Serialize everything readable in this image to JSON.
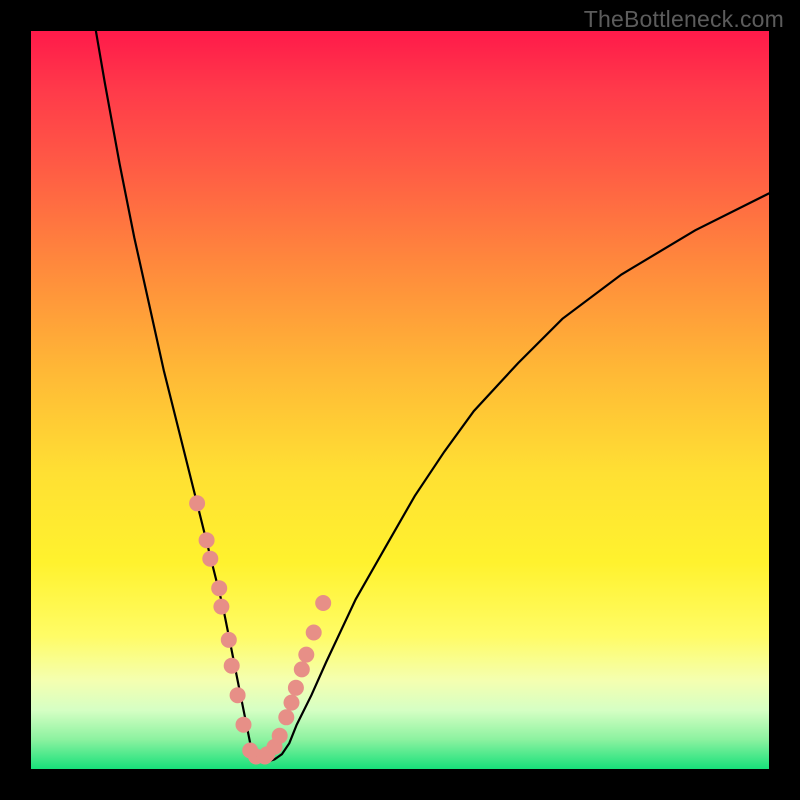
{
  "watermark": "TheBottleneck.com",
  "chart_data": {
    "type": "line",
    "title": "",
    "xlabel": "",
    "ylabel": "",
    "xlim": [
      0,
      100
    ],
    "ylim": [
      0,
      100
    ],
    "grid": false,
    "notes": "No axis ticks or numeric labels are visible; values are normalized 0–100 to the plot area. Colored background is a smooth gradient from red (top) through orange/yellow to green (bottom). A black V-shaped curve descends steeply on the left, touches the bottom near x≈30, and rises more gradually toward the right edge. Salmon dot markers cluster on both flanks of the valley.",
    "series": [
      {
        "name": "curve",
        "color": "#000000",
        "x": [
          8.8,
          10,
          12,
          14,
          16,
          18,
          20,
          22,
          24,
          26,
          27,
          28,
          29,
          30,
          31,
          32,
          33,
          34,
          35,
          36,
          38,
          40,
          44,
          48,
          52,
          56,
          60,
          66,
          72,
          80,
          90,
          100
        ],
        "y": [
          100,
          93,
          82,
          72,
          63,
          54,
          46,
          38,
          30,
          22,
          17,
          12,
          7,
          2,
          1,
          1,
          1.3,
          2,
          3.5,
          6,
          10,
          14.5,
          23,
          30,
          37,
          43,
          48.5,
          55,
          61,
          67,
          73,
          78
        ]
      },
      {
        "name": "markers",
        "color": "#e78f87",
        "type": "scatter",
        "x": [
          22.5,
          23.8,
          24.3,
          25.5,
          25.8,
          26.8,
          27.2,
          28.0,
          28.8,
          29.7,
          30.5,
          31.7,
          32.0,
          33.0,
          33.7,
          34.6,
          35.3,
          35.9,
          36.7,
          37.3,
          38.3,
          39.6
        ],
        "y": [
          36,
          31,
          28.5,
          24.5,
          22,
          17.5,
          14,
          10,
          6,
          2.5,
          1.7,
          1.7,
          2,
          3,
          4.5,
          7,
          9,
          11,
          13.5,
          15.5,
          18.5,
          22.5
        ]
      }
    ]
  }
}
